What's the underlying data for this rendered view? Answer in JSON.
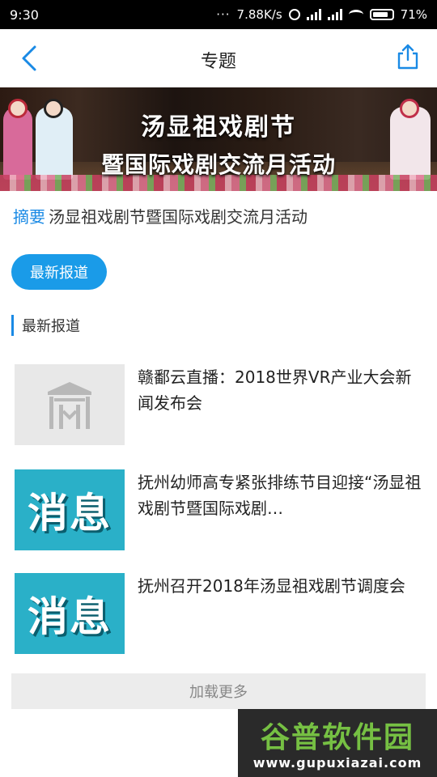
{
  "status": {
    "time": "9:30",
    "dots": "···",
    "speed": "7.88K/s",
    "battery": "71%"
  },
  "header": {
    "title": "专题",
    "back_icon": "chevron-left-icon",
    "share_icon": "share-icon"
  },
  "banner": {
    "line1": "汤显祖戏剧节",
    "line2": "暨国际戏剧交流月活动"
  },
  "summary": {
    "label": "摘要",
    "text": "汤显祖戏剧节暨国际戏剧交流月活动"
  },
  "chip": {
    "label": "最新报道"
  },
  "section": {
    "title": "最新报道"
  },
  "news": [
    {
      "title": "赣鄱云直播：2018世界VR产业大会新闻发布会",
      "thumb_type": "placeholder"
    },
    {
      "title": "抚州幼师高专紧张排练节目迎接“汤显祖戏剧节暨国际戏剧…",
      "thumb_type": "message",
      "thumb_text": "消息"
    },
    {
      "title": "抚州召开2018年汤显祖戏剧节调度会",
      "thumb_type": "message",
      "thumb_text": "消息"
    }
  ],
  "loadmore": {
    "label": "加载更多"
  },
  "watermark": {
    "title": "谷普软件园",
    "url": "www.gupuxiazai.com"
  },
  "colors": {
    "accent": "#1a8ae5",
    "chip": "#1a9be8",
    "message_thumb": "#2ab0c8"
  }
}
